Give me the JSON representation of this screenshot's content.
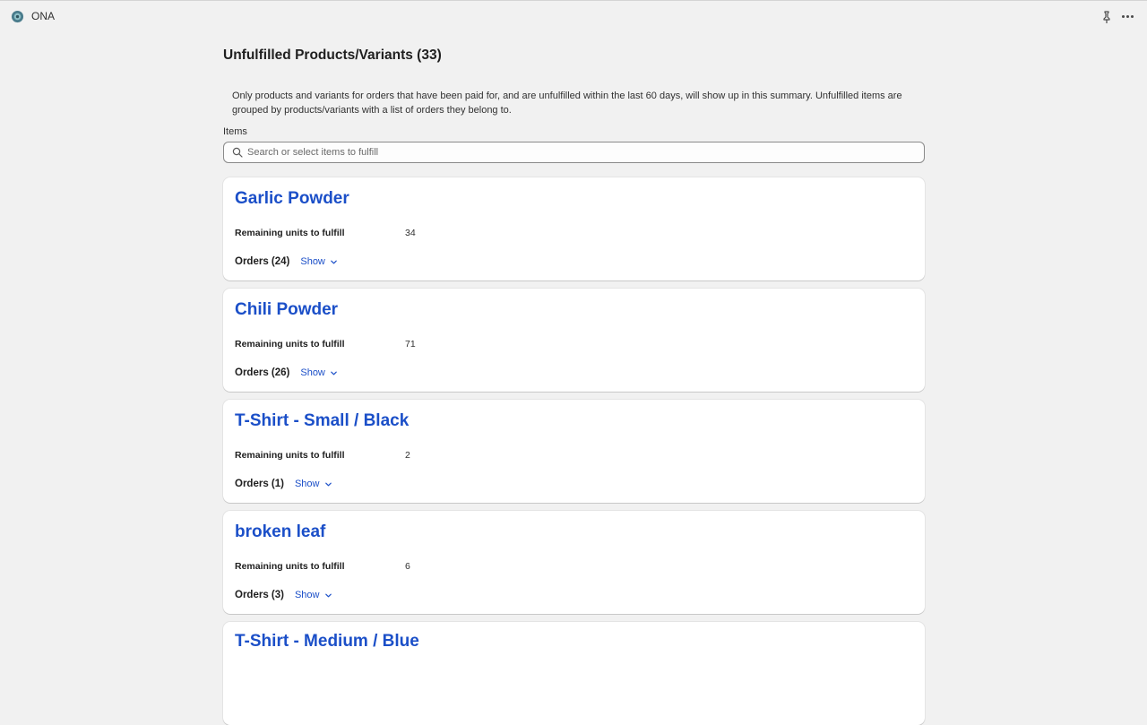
{
  "app": {
    "name": "ONA",
    "icons": {
      "logo": "app-logo-icon",
      "pin": "pin-icon",
      "more": "more-horizontal-icon"
    }
  },
  "page": {
    "title": "Unfulfilled Products/Variants (33)",
    "description": "Only products and variants for orders that have been paid for, and are unfulfilled within the last 60 days, will show up in this summary. Unfulfilled items are grouped by products/variants with a list of orders they belong to.",
    "items_label": "Items",
    "search": {
      "placeholder": "Search or select items to fulfill",
      "value": "",
      "icon": "search-icon"
    }
  },
  "cards": [
    {
      "title": "Garlic Powder",
      "remaining_label": "Remaining units to fulfill",
      "remaining_value": "34",
      "orders_label": "Orders (24)",
      "show_label": "Show"
    },
    {
      "title": "Chili Powder",
      "remaining_label": "Remaining units to fulfill",
      "remaining_value": "71",
      "orders_label": "Orders (26)",
      "show_label": "Show"
    },
    {
      "title": "T-Shirt - Small / Black",
      "remaining_label": "Remaining units to fulfill",
      "remaining_value": "2",
      "orders_label": "Orders (1)",
      "show_label": "Show"
    },
    {
      "title": "broken leaf",
      "remaining_label": "Remaining units to fulfill",
      "remaining_value": "6",
      "orders_label": "Orders (3)",
      "show_label": "Show"
    },
    {
      "title": "T-Shirt - Medium / Blue",
      "remaining_label": "",
      "remaining_value": "",
      "orders_label": "",
      "show_label": ""
    }
  ],
  "colors": {
    "link_blue": "#1b4fc8",
    "background": "#f1f1f1",
    "card": "#ffffff"
  }
}
